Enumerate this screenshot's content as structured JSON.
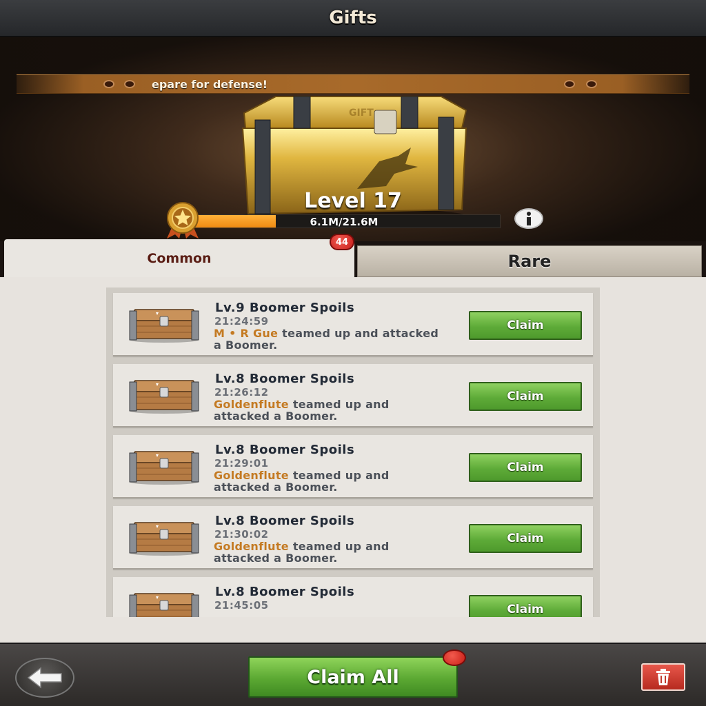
{
  "header": {
    "title": "Gifts"
  },
  "hero": {
    "ticker_text": "epare for defense!",
    "level_label": "Level 17",
    "progress_text": "6.1M/21.6M",
    "progress_fraction": 0.28,
    "info_icon": "info-icon",
    "medal_icon": "star-medal-icon"
  },
  "tabs": [
    {
      "label": "Common",
      "badge": "44",
      "selected": true
    },
    {
      "label": "Rare",
      "selected": false
    }
  ],
  "gifts": [
    {
      "title": "Lv.9 Boomer Spoils",
      "time": "21:24:59",
      "player": "M • R Gue",
      "text": " teamed up and attacked a Boomer.",
      "button": "Claim"
    },
    {
      "title": "Lv.8 Boomer Spoils",
      "time": "21:26:12",
      "player": "Goldenflute",
      "text": " teamed up and attacked a Boomer.",
      "button": "Claim"
    },
    {
      "title": "Lv.8 Boomer Spoils",
      "time": "21:29:01",
      "player": "Goldenflute",
      "text": " teamed up and attacked a Boomer.",
      "button": "Claim"
    },
    {
      "title": "Lv.8 Boomer Spoils",
      "time": "21:30:02",
      "player": "Goldenflute",
      "text": " teamed up and attacked a Boomer.",
      "button": "Claim"
    },
    {
      "title": "Lv.8 Boomer Spoils",
      "time": "21:45:05",
      "player": "",
      "text": "",
      "button": "Claim"
    }
  ],
  "footer": {
    "claim_all_label": "Claim All",
    "back_icon": "back-arrow-icon",
    "trash_icon": "trash-icon"
  },
  "colors": {
    "claim_green": "#5eab38",
    "player_name": "#c47a22",
    "badge_red": "#c8201c",
    "progress_orange": "#ef8a12"
  }
}
